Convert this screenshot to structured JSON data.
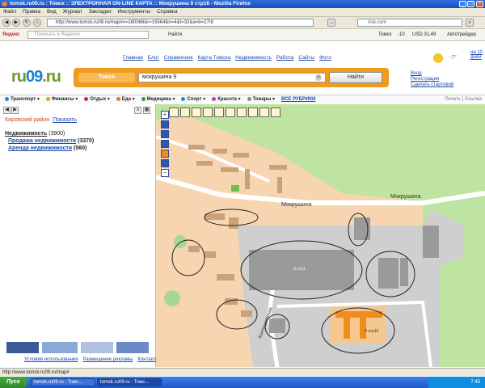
{
  "window": {
    "title": "tomsk.ru09.ru : Томск :: ЭЛЕКТРОННАЯ ON-LINE КАРТА :: Мокрушина 9 стр16 - Mozilla Firefox"
  },
  "menu": [
    "Файл",
    "Правка",
    "Вид",
    "Журнал",
    "Закладки",
    "Инструменты",
    "Справка"
  ],
  "browser": {
    "url": "http://www.tomsk.ru09.ru/map#v=180068&r=15564&n=4&t=32&a=b=27!8",
    "search_placeholder": "Ask.com"
  },
  "yabar": {
    "brand": "Яндекс",
    "input_placeholder": "Поискать в Яндексе",
    "find": "Найти",
    "city": "Томск",
    "temp": "-10",
    "currency": "USD 31,49",
    "autotrade": "Автотрейдер"
  },
  "site": {
    "logo_a": "ru",
    "logo_b": "09",
    "logo_c": ".ru",
    "topnav": [
      "Главная",
      "Блог",
      "Справочник",
      "Карта Томска",
      "Недвижимость",
      "Работа",
      "Сайты",
      "Фото"
    ],
    "city": "Томск",
    "query": "мокрушина 9",
    "find_button": "Найти",
    "weather_temp": "-7°",
    "weather_link": "на 10 дней",
    "login": "Вход",
    "register": "Регистрация",
    "make_home": "Сделать стартовой"
  },
  "categories": [
    {
      "label": "Транспорт",
      "color": "#3a7ad8"
    },
    {
      "label": "Финансы",
      "color": "#e0a020"
    },
    {
      "label": "Отдых",
      "color": "#d03030"
    },
    {
      "label": "Еда",
      "color": "#e07a20"
    },
    {
      "label": "Медицина",
      "color": "#30a040"
    },
    {
      "label": "Спорт",
      "color": "#2a8ad0"
    },
    {
      "label": "Красота",
      "color": "#c040a0"
    },
    {
      "label": "Товары",
      "color": "#888888"
    }
  ],
  "all_rubrics": "ВСЕ РУБРИКИ",
  "print": "Печать",
  "link": "Ссылка",
  "panel": {
    "district": "Кировский район",
    "show": "Показать",
    "results": [
      {
        "label": "Недвижимость",
        "count": "(3900)"
      },
      {
        "label": "Продажа недвижимости",
        "count": "(3370)"
      },
      {
        "label": "Аренда недвижимости",
        "count": "(560)"
      }
    ],
    "footer": [
      "Условия использования",
      "Размещение рекламы",
      "Контакты"
    ]
  },
  "map": {
    "street1": "Мокрушина",
    "street2": "Мокрушина",
    "street3": "Колпашевская",
    "label_big": "9 стр1",
    "label_highlight": "9 стр16"
  },
  "statusbar": "http://www.tomsk.ru09.ru/map#",
  "taskbar": {
    "start": "Пуск",
    "tasks": [
      "tomsk.ru09.ru : Томс...",
      "tomsk.ru09.ru : Томс..."
    ],
    "clock": "7:45"
  }
}
